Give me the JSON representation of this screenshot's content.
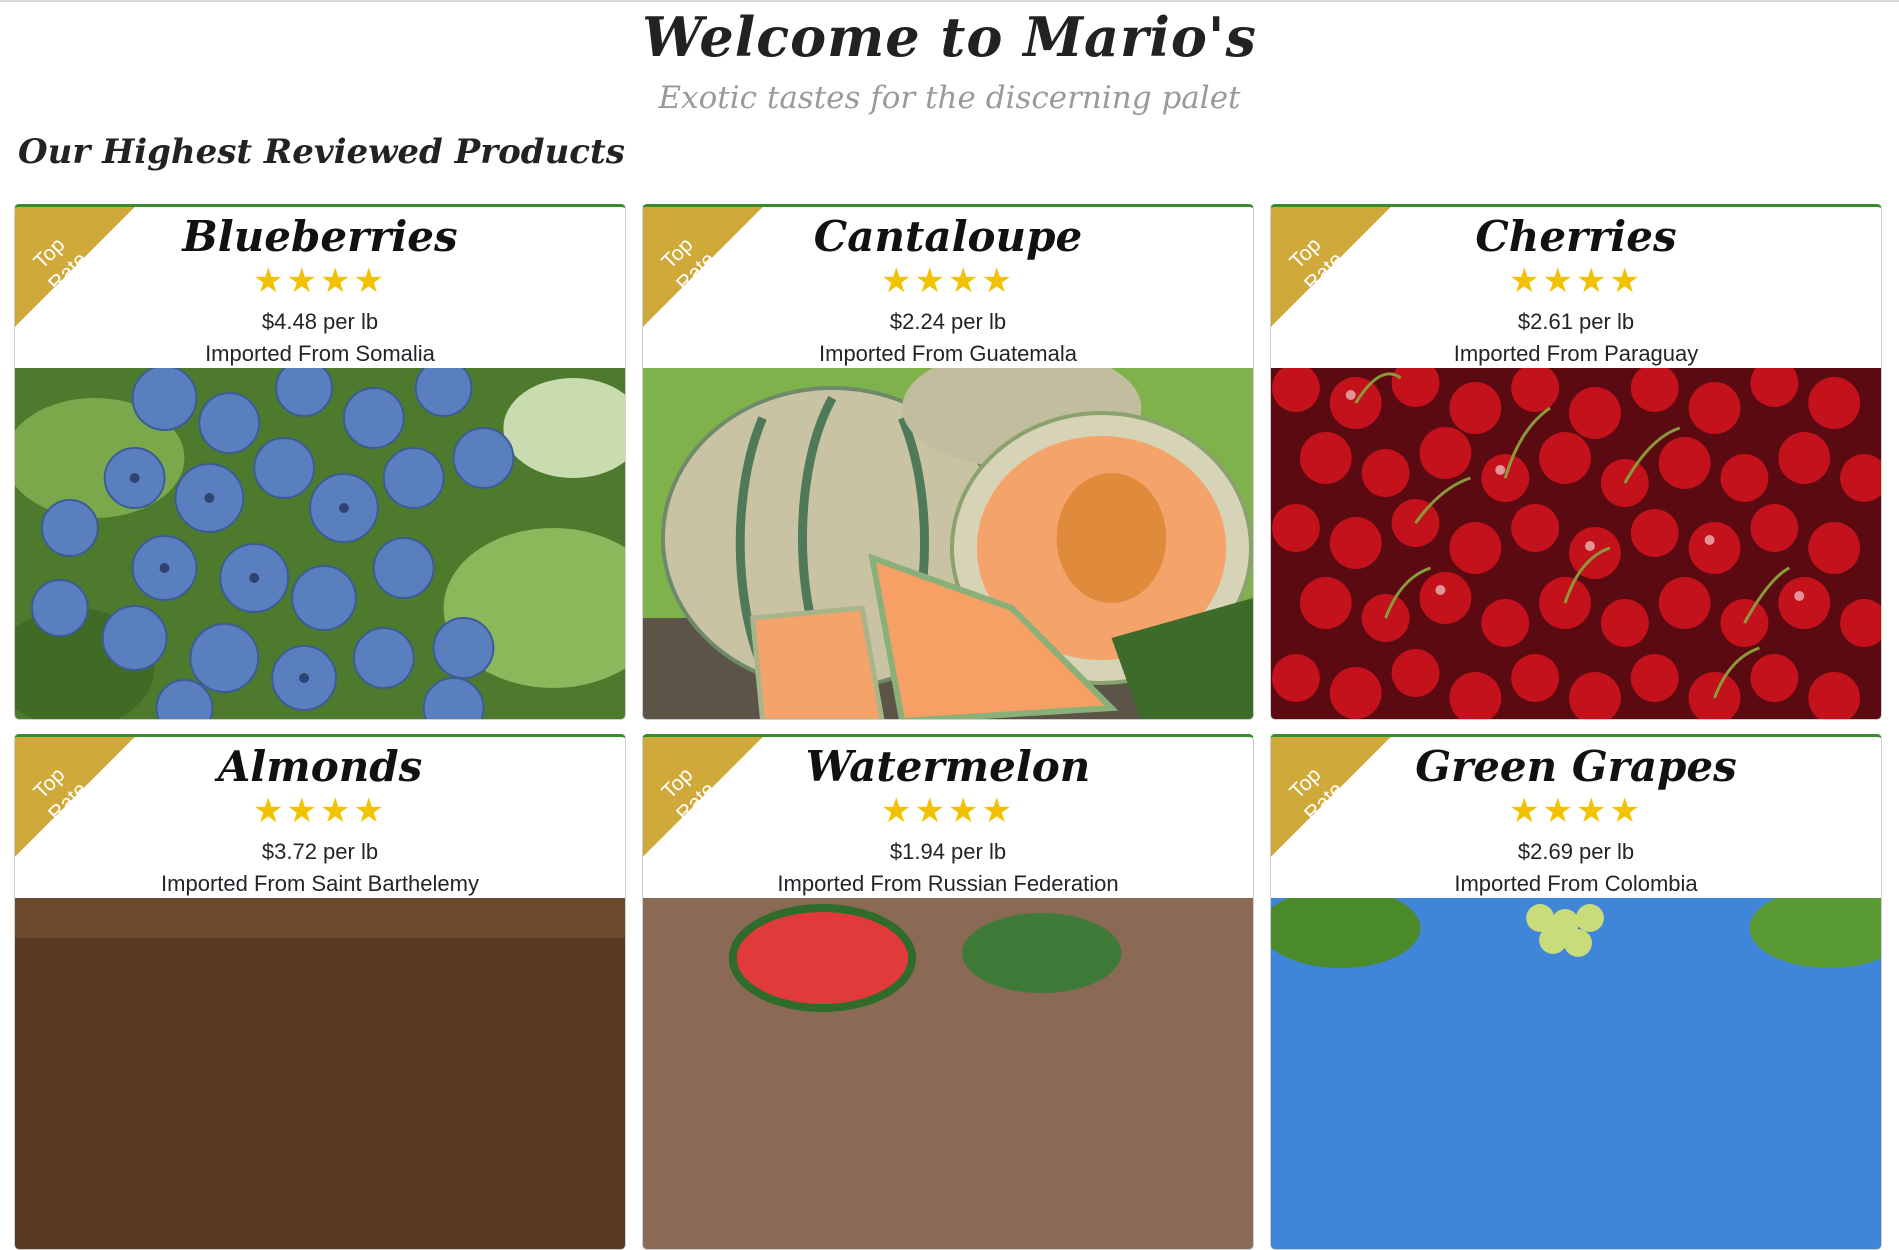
{
  "site_title": "Welcome to Mario's",
  "tagline": "Exotic tastes for the discerning palet",
  "section_title": "Our Highest Reviewed Products",
  "ribbon_label_top": "Top",
  "ribbon_label_bottom": "Rate",
  "products": [
    {
      "name": "Blueberries",
      "rating": 4,
      "stars": "★★★★",
      "price": "$4.48 per lb",
      "origin": "Imported From Somalia"
    },
    {
      "name": "Cantaloupe",
      "rating": 4,
      "stars": "★★★★",
      "price": "$2.24 per lb",
      "origin": "Imported From Guatemala"
    },
    {
      "name": "Cherries",
      "rating": 4,
      "stars": "★★★★",
      "price": "$2.61 per lb",
      "origin": "Imported From Paraguay"
    },
    {
      "name": "Almonds",
      "rating": 4,
      "stars": "★★★★",
      "price": "$3.72 per lb",
      "origin": "Imported From Saint Barthelemy"
    },
    {
      "name": "Watermelon",
      "rating": 4,
      "stars": "★★★★",
      "price": "$1.94 per lb",
      "origin": "Imported From Russian Federation"
    },
    {
      "name": "Green Grapes",
      "rating": 4,
      "stars": "★★★★",
      "price": "$2.69 per lb",
      "origin": "Imported From Colombia"
    }
  ]
}
